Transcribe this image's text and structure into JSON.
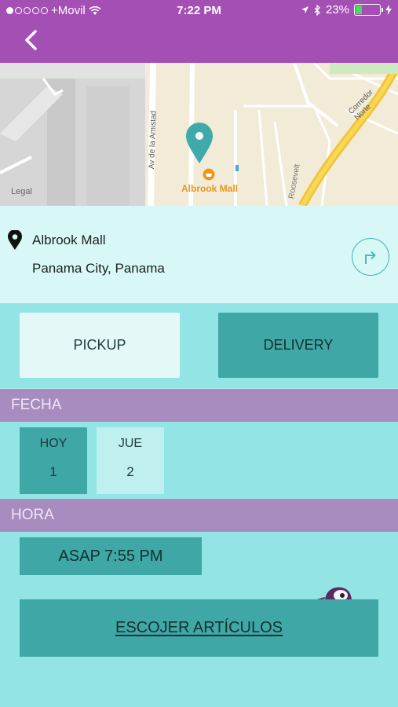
{
  "status_bar": {
    "carrier": "+Movil",
    "time": "7:22 PM",
    "battery_percent": "23%",
    "battery_level": 0.23,
    "icons": [
      "wifi-icon",
      "location-arrow-icon",
      "bluetooth-icon",
      "charging-bolt-icon"
    ]
  },
  "nav": {
    "back_icon": "chevron-left-icon"
  },
  "map": {
    "legal": "Legal",
    "poi_name": "Albrook Mall",
    "street_1": "Av de la Amistad",
    "street_2": "Corredor Norte",
    "street_3": "Roosevelt"
  },
  "location": {
    "name": "Albrook Mall",
    "city": "Panama City, Panama"
  },
  "order_mode": {
    "pickup_label": "PICKUP",
    "delivery_label": "DELIVERY",
    "selected": "DELIVERY"
  },
  "date_section": {
    "title": "FECHA",
    "options": [
      {
        "day": "HOY",
        "date": "1",
        "selected": true
      },
      {
        "day": "JUE",
        "date": "2",
        "selected": false
      }
    ]
  },
  "time_section": {
    "title": "HORA",
    "selected_time": "ASAP 7:55 PM"
  },
  "cta": {
    "label": "ESCOJER ARTÍCULOS"
  },
  "colors": {
    "nav_bg": "#a44fb4",
    "accent_teal": "#3fa7a6",
    "section_header": "#a98cbf",
    "poi": "#e9981e"
  }
}
